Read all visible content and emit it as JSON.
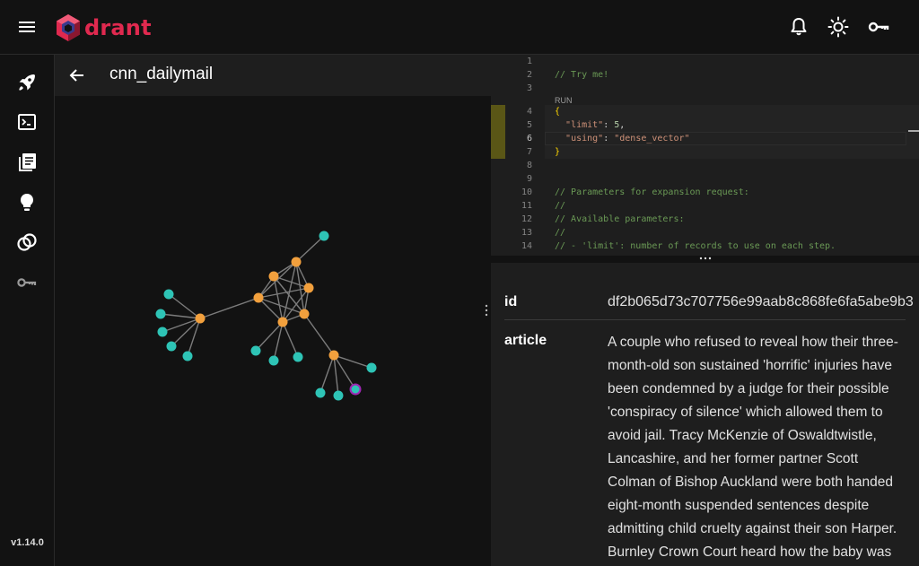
{
  "app": {
    "logo_text": "drant",
    "version": "v1.14.0",
    "accent": "#e0294f"
  },
  "topbar": {
    "icons": [
      "menu-icon",
      "bell-icon",
      "sun-icon",
      "key-icon"
    ]
  },
  "sidebar": {
    "items": [
      "rocket-icon",
      "console-icon",
      "collections-icon",
      "lightbulb-icon",
      "datasets-icon",
      "api-key-icon"
    ]
  },
  "collection": {
    "title": "cnn_dailymail"
  },
  "editor": {
    "run_label": "RUN",
    "line_numbers": [
      "1",
      "2",
      "3",
      "4",
      "5",
      "6",
      "7",
      "8",
      "9",
      "10",
      "11",
      "12",
      "13",
      "14"
    ],
    "lines": {
      "l2": "// Try me!",
      "l4": "{",
      "l5_key": "\"limit\"",
      "l5_sep": ": ",
      "l5_val": "5",
      "l5_end": ",",
      "l6_key": "\"using\"",
      "l6_sep": ": ",
      "l6_val": "\"dense_vector\"",
      "l7": "}",
      "l10": "// Parameters for expansion request:",
      "l11": "//",
      "l12": "// Available parameters:",
      "l13": "//",
      "l14": "// - 'limit': number of records to use on each step."
    }
  },
  "point": {
    "id_label": "id",
    "id_value": "df2b065d73c707756e99aab8c868fe6fa5abe9b3",
    "article_label": "article",
    "article_value": "A couple who refused to reveal how their three-month-old son sustained 'horrific' injuries have been condemned by a judge for their possible 'conspiracy of silence' which allowed them to avoid jail. Tracy McKenzie of Oswaldtwistle, Lancashire, and her former partner Scott Colman of Bishop Auckland were both handed eight-month suspended sentences despite admitting child cruelty against their son Harper. Burnley Crown Court heard how the baby was"
  },
  "graph": {
    "colors": {
      "hub": "#f2a03d",
      "leaf": "#2ec4b6",
      "selected_ring": "#9c27b0",
      "edge": "#9e9e9e"
    }
  }
}
